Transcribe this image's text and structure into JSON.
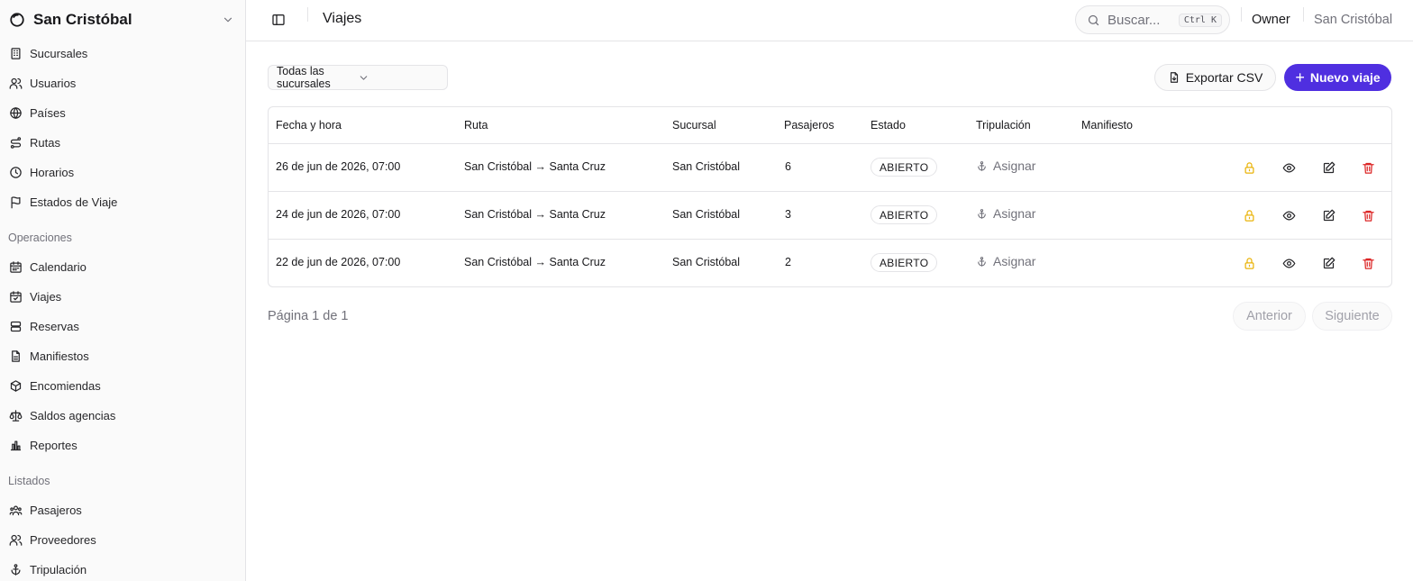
{
  "sidebar": {
    "brand": "San Cristóbal",
    "main_items": [
      {
        "label": "Sucursales",
        "icon": "building-icon"
      },
      {
        "label": "Usuarios",
        "icon": "users-icon"
      },
      {
        "label": "Países",
        "icon": "globe-icon"
      },
      {
        "label": "Rutas",
        "icon": "route-icon"
      },
      {
        "label": "Horarios",
        "icon": "clock-icon"
      },
      {
        "label": "Estados de Viaje",
        "icon": "flag-icon"
      }
    ],
    "section_operaciones": "Operaciones",
    "operaciones_items": [
      {
        "label": "Calendario",
        "icon": "calendar-icon"
      },
      {
        "label": "Viajes",
        "icon": "calendar-check-icon"
      },
      {
        "label": "Reservas",
        "icon": "layers-icon"
      },
      {
        "label": "Manifiestos",
        "icon": "file-icon"
      },
      {
        "label": "Encomiendas",
        "icon": "package-icon"
      },
      {
        "label": "Saldos agencias",
        "icon": "scale-icon"
      },
      {
        "label": "Reportes",
        "icon": "bar-chart-icon"
      }
    ],
    "section_listados": "Listados",
    "listados_items": [
      {
        "label": "Pasajeros",
        "icon": "users-group-icon"
      },
      {
        "label": "Proveedores",
        "icon": "users-icon"
      },
      {
        "label": "Tripulación",
        "icon": "anchor-icon"
      }
    ]
  },
  "header": {
    "title": "Viajes",
    "search_placeholder": "Buscar...",
    "search_shortcut": "Ctrl K",
    "role": "Owner",
    "org": "San Cristóbal"
  },
  "toolbar": {
    "filter_value": "Todas las sucursales",
    "export_label": "Exportar CSV",
    "new_label": "Nuevo viaje"
  },
  "table": {
    "columns": [
      "Fecha y hora",
      "Ruta",
      "Sucursal",
      "Pasajeros",
      "Estado",
      "Tripulación",
      "Manifiesto"
    ],
    "rows": [
      {
        "fecha": "26 de jun de 2026, 07:00",
        "ruta": "San Cristóbal → Santa Cruz",
        "sucursal": "San Cristóbal",
        "pasajeros": "6",
        "estado": "ABIERTO",
        "tripulacion": "Asignar"
      },
      {
        "fecha": "24 de jun de 2026, 07:00",
        "ruta": "San Cristóbal → Santa Cruz",
        "sucursal": "San Cristóbal",
        "pasajeros": "3",
        "estado": "ABIERTO",
        "tripulacion": "Asignar"
      },
      {
        "fecha": "22 de jun de 2026, 07:00",
        "ruta": "San Cristóbal → Santa Cruz",
        "sucursal": "San Cristóbal",
        "pasajeros": "2",
        "estado": "ABIERTO",
        "tripulacion": "Asignar"
      }
    ]
  },
  "pagination": {
    "info": "Página 1 de 1",
    "prev_label": "Anterior",
    "next_label": "Siguiente"
  },
  "colors": {
    "accent": "#4f2fe0",
    "lock": "#eab308",
    "delete": "#dc2626"
  }
}
